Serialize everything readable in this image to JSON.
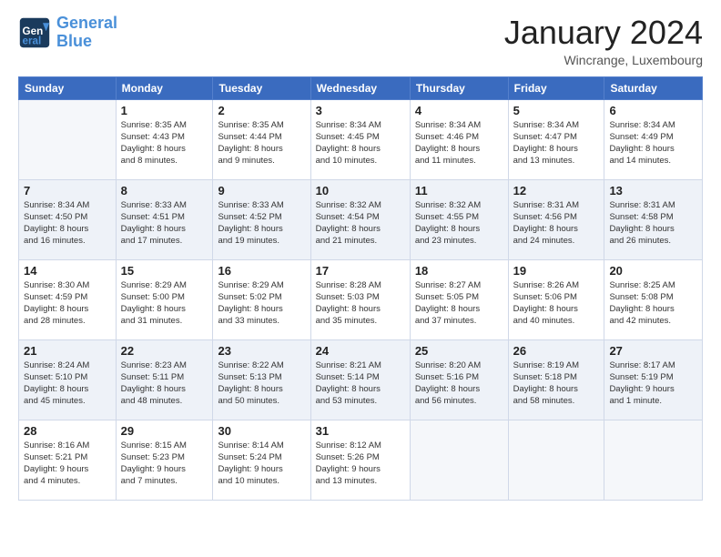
{
  "header": {
    "logo_line1": "General",
    "logo_line2": "Blue",
    "month": "January 2024",
    "location": "Wincrange, Luxembourg"
  },
  "weekdays": [
    "Sunday",
    "Monday",
    "Tuesday",
    "Wednesday",
    "Thursday",
    "Friday",
    "Saturday"
  ],
  "weeks": [
    [
      {
        "day": "",
        "info": ""
      },
      {
        "day": "1",
        "info": "Sunrise: 8:35 AM\nSunset: 4:43 PM\nDaylight: 8 hours\nand 8 minutes."
      },
      {
        "day": "2",
        "info": "Sunrise: 8:35 AM\nSunset: 4:44 PM\nDaylight: 8 hours\nand 9 minutes."
      },
      {
        "day": "3",
        "info": "Sunrise: 8:34 AM\nSunset: 4:45 PM\nDaylight: 8 hours\nand 10 minutes."
      },
      {
        "day": "4",
        "info": "Sunrise: 8:34 AM\nSunset: 4:46 PM\nDaylight: 8 hours\nand 11 minutes."
      },
      {
        "day": "5",
        "info": "Sunrise: 8:34 AM\nSunset: 4:47 PM\nDaylight: 8 hours\nand 13 minutes."
      },
      {
        "day": "6",
        "info": "Sunrise: 8:34 AM\nSunset: 4:49 PM\nDaylight: 8 hours\nand 14 minutes."
      }
    ],
    [
      {
        "day": "7",
        "info": "Sunrise: 8:34 AM\nSunset: 4:50 PM\nDaylight: 8 hours\nand 16 minutes."
      },
      {
        "day": "8",
        "info": "Sunrise: 8:33 AM\nSunset: 4:51 PM\nDaylight: 8 hours\nand 17 minutes."
      },
      {
        "day": "9",
        "info": "Sunrise: 8:33 AM\nSunset: 4:52 PM\nDaylight: 8 hours\nand 19 minutes."
      },
      {
        "day": "10",
        "info": "Sunrise: 8:32 AM\nSunset: 4:54 PM\nDaylight: 8 hours\nand 21 minutes."
      },
      {
        "day": "11",
        "info": "Sunrise: 8:32 AM\nSunset: 4:55 PM\nDaylight: 8 hours\nand 23 minutes."
      },
      {
        "day": "12",
        "info": "Sunrise: 8:31 AM\nSunset: 4:56 PM\nDaylight: 8 hours\nand 24 minutes."
      },
      {
        "day": "13",
        "info": "Sunrise: 8:31 AM\nSunset: 4:58 PM\nDaylight: 8 hours\nand 26 minutes."
      }
    ],
    [
      {
        "day": "14",
        "info": "Sunrise: 8:30 AM\nSunset: 4:59 PM\nDaylight: 8 hours\nand 28 minutes."
      },
      {
        "day": "15",
        "info": "Sunrise: 8:29 AM\nSunset: 5:00 PM\nDaylight: 8 hours\nand 31 minutes."
      },
      {
        "day": "16",
        "info": "Sunrise: 8:29 AM\nSunset: 5:02 PM\nDaylight: 8 hours\nand 33 minutes."
      },
      {
        "day": "17",
        "info": "Sunrise: 8:28 AM\nSunset: 5:03 PM\nDaylight: 8 hours\nand 35 minutes."
      },
      {
        "day": "18",
        "info": "Sunrise: 8:27 AM\nSunset: 5:05 PM\nDaylight: 8 hours\nand 37 minutes."
      },
      {
        "day": "19",
        "info": "Sunrise: 8:26 AM\nSunset: 5:06 PM\nDaylight: 8 hours\nand 40 minutes."
      },
      {
        "day": "20",
        "info": "Sunrise: 8:25 AM\nSunset: 5:08 PM\nDaylight: 8 hours\nand 42 minutes."
      }
    ],
    [
      {
        "day": "21",
        "info": "Sunrise: 8:24 AM\nSunset: 5:10 PM\nDaylight: 8 hours\nand 45 minutes."
      },
      {
        "day": "22",
        "info": "Sunrise: 8:23 AM\nSunset: 5:11 PM\nDaylight: 8 hours\nand 48 minutes."
      },
      {
        "day": "23",
        "info": "Sunrise: 8:22 AM\nSunset: 5:13 PM\nDaylight: 8 hours\nand 50 minutes."
      },
      {
        "day": "24",
        "info": "Sunrise: 8:21 AM\nSunset: 5:14 PM\nDaylight: 8 hours\nand 53 minutes."
      },
      {
        "day": "25",
        "info": "Sunrise: 8:20 AM\nSunset: 5:16 PM\nDaylight: 8 hours\nand 56 minutes."
      },
      {
        "day": "26",
        "info": "Sunrise: 8:19 AM\nSunset: 5:18 PM\nDaylight: 8 hours\nand 58 minutes."
      },
      {
        "day": "27",
        "info": "Sunrise: 8:17 AM\nSunset: 5:19 PM\nDaylight: 9 hours\nand 1 minute."
      }
    ],
    [
      {
        "day": "28",
        "info": "Sunrise: 8:16 AM\nSunset: 5:21 PM\nDaylight: 9 hours\nand 4 minutes."
      },
      {
        "day": "29",
        "info": "Sunrise: 8:15 AM\nSunset: 5:23 PM\nDaylight: 9 hours\nand 7 minutes."
      },
      {
        "day": "30",
        "info": "Sunrise: 8:14 AM\nSunset: 5:24 PM\nDaylight: 9 hours\nand 10 minutes."
      },
      {
        "day": "31",
        "info": "Sunrise: 8:12 AM\nSunset: 5:26 PM\nDaylight: 9 hours\nand 13 minutes."
      },
      {
        "day": "",
        "info": ""
      },
      {
        "day": "",
        "info": ""
      },
      {
        "day": "",
        "info": ""
      }
    ]
  ]
}
